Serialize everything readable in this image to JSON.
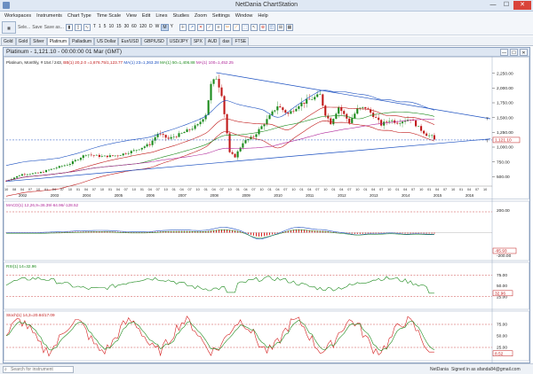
{
  "window": {
    "title": "NetDania ChartStation",
    "minimize": "—",
    "maximize": "☐",
    "close": "✕"
  },
  "menu": [
    "Workspaces",
    "Instruments",
    "Chart Type",
    "Time Scale",
    "View",
    "Edit",
    "Lines",
    "Studies",
    "Zoom",
    "Settings",
    "Window",
    "Help"
  ],
  "toolbar": {
    "select_label": "Sele...",
    "save_label": "Save",
    "save_as_label": "Save as...",
    "period_buttons": [
      "T",
      "1",
      "5",
      "10",
      "15",
      "30",
      "60",
      "120",
      "D",
      "W",
      "M",
      "Y"
    ],
    "active_period": "M",
    "tool_icons": [
      "＋",
      "↗",
      "✕",
      "∕",
      "≡",
      "✂",
      "⟋",
      "⬚",
      "↖",
      "⊕",
      "◫",
      "⊞",
      "▦"
    ]
  },
  "instrument_tabs": [
    "Gold",
    "Gold",
    "Silver",
    "Platinum",
    "Palladium",
    "US Dollar",
    "Eur/USD",
    "GBP/USD",
    "USD/JPY",
    "SPX",
    "AUD",
    "dax",
    "FTSE"
  ],
  "active_tab": "Platinum",
  "chart": {
    "title": "Platinum - 1,121.10 - 00:00:00  01 Mar (GMT)",
    "legend_main": {
      "prefix": "Platinum, Monthly, # 154 / 243,",
      "parts": [
        {
          "text": " BB(1) 20,2.0 =1,676.75/1,123.77",
          "color": "#c01818"
        },
        {
          "text": " MA(1) 23=1,363.28",
          "color": "#1a4fc0"
        },
        {
          "text": " MA(1) 50=1,406.88",
          "color": "#1d8a1d"
        },
        {
          "text": " MA(1) 100=1,452.25",
          "color": "#b0279a"
        }
      ]
    },
    "price_axis": [
      "2,250.00",
      "2,000.00",
      "1,750.00",
      "1,500.00",
      "1,250.00",
      "1,000.00",
      "750.00",
      "500.00"
    ],
    "price_tag": "1,121.10",
    "trendline_labels": [
      "T",
      "T"
    ],
    "x_month_row": [
      "10",
      "08",
      "04",
      "07",
      "10",
      "01",
      "04",
      "07",
      "10",
      "01",
      "04",
      "07",
      "10",
      "01",
      "04",
      "07",
      "10",
      "01",
      "04",
      "07",
      "10",
      "01",
      "04",
      "07",
      "10",
      "01",
      "04",
      "07",
      "10",
      "01",
      "04",
      "07",
      "10",
      "01",
      "04",
      "07",
      "10",
      "01",
      "04",
      "07",
      "10",
      "01",
      "04",
      "07",
      "10",
      "01",
      "04",
      "07",
      "10",
      "01",
      "04",
      "07",
      "10",
      "01",
      "04",
      "07",
      "10",
      "01",
      "04",
      "07",
      "10",
      "01",
      "04",
      "07",
      "10",
      "01",
      "04",
      "07",
      "10",
      "01",
      "04",
      "07",
      "10",
      "01",
      "04",
      "07",
      "10",
      "01",
      "04",
      "07",
      "10",
      "01",
      "04",
      "07",
      "10",
      "01",
      "04",
      "07",
      "10",
      "01",
      "04",
      "07",
      "10",
      "01",
      "04",
      "07",
      "10",
      "01",
      "04",
      "07",
      "10",
      "01",
      "04",
      "07",
      "10",
      "01",
      "04",
      "07",
      "10"
    ],
    "x_year_row": [
      "2002",
      "2003",
      "2004",
      "2005",
      "2006",
      "2007",
      "2008",
      "2009",
      "2010",
      "2011",
      "2012",
      "2013",
      "2014",
      "2015",
      "2016"
    ],
    "macd": {
      "legend": "MACD(1) 12,26,9=36.39/-64.96/-128.52",
      "axis_top": "200.00",
      "axis_bottom": "-200.00",
      "tag": "-65.93"
    },
    "rsi": {
      "legend": "RSI(1) 14=32.96",
      "axis": [
        "75.00",
        "50.00",
        "25.00"
      ],
      "tag": "32.96"
    },
    "stoch": {
      "legend": "Stoch(1) 14,3=20.84/17.09",
      "axis": [
        "75.00",
        "50.00",
        "25.00"
      ],
      "tag": "8.52"
    }
  },
  "status": {
    "search_placeholder": "Search for instrument",
    "brand": "NetDania",
    "signed_in": "Signed in as afanda84@gmail.com"
  },
  "chart_data": {
    "type": "line",
    "title": "Platinum - 1,121.10 - 00:00:00  01 Mar (GMT)",
    "xlabel": "",
    "ylabel": "",
    "x_range": [
      "2001-10",
      "2016-12"
    ],
    "ylim": [
      400,
      2350
    ],
    "last_price": 1121.1,
    "series": [
      {
        "name": "Platinum",
        "values_by_year": {
          "2002": 520,
          "2003": 650,
          "2004": 850,
          "2005": 900,
          "2006": 1150,
          "2007": 1450,
          "2008": 2250,
          "2008-10": 790,
          "2009": 1200,
          "2010": 1700,
          "2011": 1800,
          "2012": 1600,
          "2013": 1450,
          "2014": 1400,
          "2015": 1121.1
        }
      }
    ],
    "indicators": [
      "BB(1) 20,2.0",
      "MA(1) 23",
      "MA(1) 50",
      "MA(1) 100",
      "MACD(1) 12,26,9",
      "RSI(1) 14",
      "Stoch(1) 14,3"
    ],
    "grid": false
  }
}
